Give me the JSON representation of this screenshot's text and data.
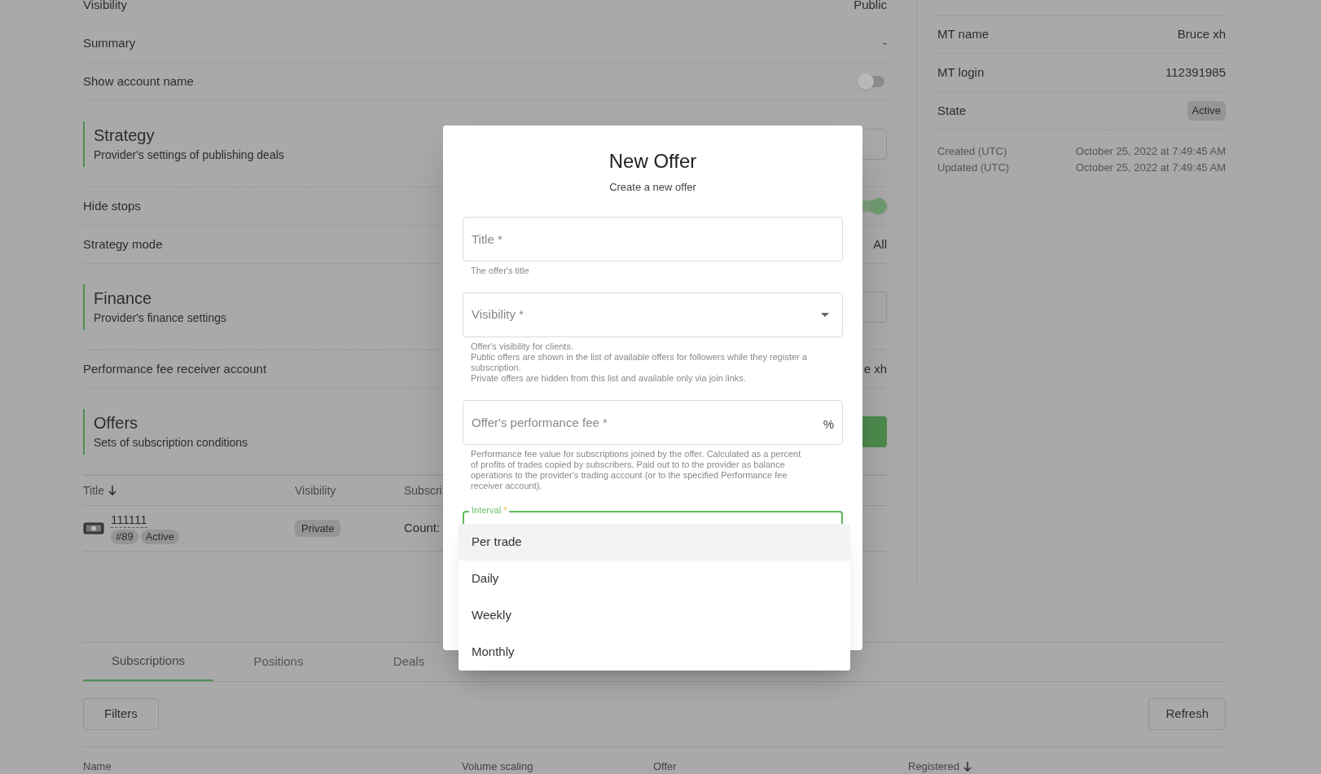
{
  "settings_rows": [
    {
      "kind": "row",
      "label": "Visibility",
      "value": "Public"
    },
    {
      "kind": "row",
      "label": "Summary",
      "value": "-"
    },
    {
      "kind": "toggle",
      "label": "Show account name",
      "on": false
    },
    {
      "kind": "section",
      "title": "Strategy",
      "subtitle": "Provider's settings of publishing deals",
      "button": {
        "kind": "outline"
      }
    },
    {
      "kind": "toggle",
      "label": "Hide stops",
      "on": true
    },
    {
      "kind": "row",
      "label": "Strategy mode",
      "value": "All"
    },
    {
      "kind": "section",
      "title": "Finance",
      "subtitle": "Provider's finance settings",
      "button": {
        "kind": "outline"
      }
    },
    {
      "kind": "row",
      "label": "Performance fee receiver account",
      "value": "e xh"
    },
    {
      "kind": "section",
      "title": "Offers",
      "subtitle": "Sets of subscription conditions",
      "button": {
        "kind": "filled"
      }
    }
  ],
  "offers_table": {
    "columns": [
      {
        "label": "Title",
        "sorted": true
      },
      {
        "label": "Visibility",
        "sorted": false
      },
      {
        "label": "Subscri",
        "sorted": false
      }
    ],
    "rows": [
      {
        "title": "111111",
        "number": "#89",
        "state": "Active",
        "visibility": "Private",
        "subscriptions": "Count:"
      }
    ]
  },
  "account": {
    "rows": [
      {
        "kind": "row",
        "label": "MT name",
        "value": "Bruce xh"
      },
      {
        "kind": "row",
        "label": "MT login",
        "value": "112391985"
      },
      {
        "kind": "badge",
        "label": "State",
        "value": "Active"
      }
    ],
    "dates": [
      {
        "label": "Created (UTC)",
        "value": "October 25, 2022 at 7:49:45 AM"
      },
      {
        "label": "Updated (UTC)",
        "value": "October 25, 2022 at 7:49:45 AM"
      }
    ]
  },
  "bottom_tabs": [
    {
      "label": "Subscriptions",
      "selected": true
    },
    {
      "label": "Positions",
      "selected": false
    },
    {
      "label": "Deals",
      "selected": false
    }
  ],
  "filters_button": "Filters",
  "refresh_button": "Refresh",
  "subscriptions_table": {
    "columns": [
      {
        "label": "Name",
        "sorted": false
      },
      {
        "label": "Volume scaling",
        "sorted": false
      },
      {
        "label": "Offer",
        "sorted": false
      },
      {
        "label": "Registered",
        "sorted": true
      }
    ]
  },
  "modal": {
    "title": "New Offer",
    "subtitle": "Create a new offer",
    "fields": [
      {
        "kind": "text",
        "placeholder": "Title *",
        "helper": [
          "The offer's title"
        ]
      },
      {
        "kind": "select",
        "placeholder": "Visibility *",
        "helper": [
          "Offer's visibility for clients.",
          "Public offers are shown in the list of available offers for followers while they register a subscription.",
          "Private offers are hidden from this list and available only via join links."
        ]
      },
      {
        "kind": "number",
        "placeholder": "Offer's performance fee *",
        "suffix": "%",
        "helper": [
          "Performance fee value for subscriptions joined by the offer. Calculated as a percent of profits of trades copied by subscribers. Paid out to to the provider as balance operations to the provider's trading account (or to the specified Performance fee receiver account)."
        ]
      },
      {
        "kind": "open_select",
        "label": "Interval",
        "required_mark": "*"
      }
    ],
    "dropdown": [
      {
        "label": "Per trade",
        "selected": true
      },
      {
        "label": "Daily",
        "selected": false
      },
      {
        "label": "Weekly",
        "selected": false
      },
      {
        "label": "Monthly",
        "selected": false
      }
    ]
  }
}
